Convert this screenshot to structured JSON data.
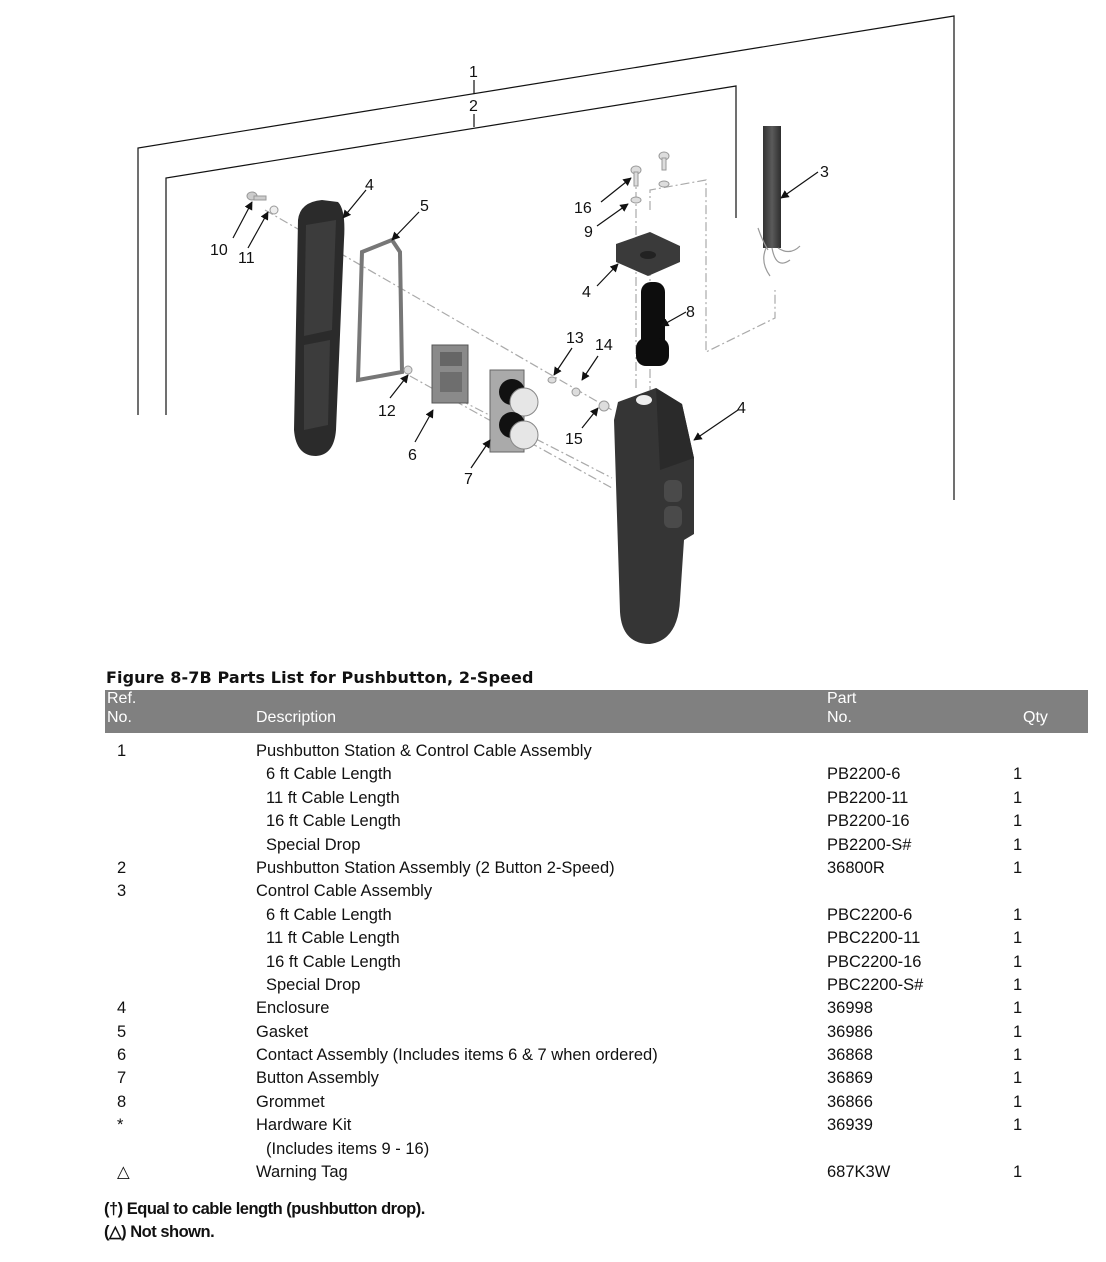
{
  "diagram": {
    "callouts": [
      "1",
      "2",
      "3",
      "4",
      "5",
      "4",
      "4",
      "8",
      "16",
      "9",
      "10",
      "11",
      "12",
      "6",
      "7",
      "13",
      "14",
      "15"
    ]
  },
  "figure_title": "Figure 8-7B  Parts List for Pushbutton, 2-Speed",
  "table": {
    "headers": {
      "ref_line1": "Ref.",
      "ref_line2": "No.",
      "description": "Description",
      "part_line1": "Part",
      "part_line2": "No.",
      "qty": "Qty"
    },
    "rows": [
      {
        "ref": "1",
        "description": "Pushbutton Station & Control Cable Assembly",
        "part": "",
        "qty": "",
        "sub": false
      },
      {
        "ref": "",
        "description": "6 ft Cable Length",
        "part": "PB2200-6",
        "qty": "1",
        "sub": true
      },
      {
        "ref": "",
        "description": "11 ft Cable Length",
        "part": "PB2200-11",
        "qty": "1",
        "sub": true
      },
      {
        "ref": "",
        "description": "16 ft Cable Length",
        "part": "PB2200-16",
        "qty": "1",
        "sub": true
      },
      {
        "ref": "",
        "description": "Special Drop",
        "part": "PB2200-S#",
        "qty": "1",
        "sub": true
      },
      {
        "ref": "2",
        "description": "Pushbutton Station Assembly (2 Button 2-Speed)",
        "part": "36800R",
        "qty": "1",
        "sub": false
      },
      {
        "ref": "3",
        "description": "Control Cable Assembly",
        "part": "",
        "qty": "",
        "sub": false
      },
      {
        "ref": "",
        "description": "6 ft Cable Length",
        "part": "PBC2200-6",
        "qty": "1",
        "sub": true
      },
      {
        "ref": "",
        "description": "11 ft Cable Length",
        "part": "PBC2200-11",
        "qty": "1",
        "sub": true
      },
      {
        "ref": "",
        "description": "16 ft Cable Length",
        "part": "PBC2200-16",
        "qty": "1",
        "sub": true
      },
      {
        "ref": "",
        "description": "Special Drop",
        "part": "PBC2200-S#",
        "qty": "1",
        "sub": true
      },
      {
        "ref": "4",
        "description": "Enclosure",
        "part": "36998",
        "qty": "1",
        "sub": false
      },
      {
        "ref": "5",
        "description": "Gasket",
        "part": "36986",
        "qty": "1",
        "sub": false
      },
      {
        "ref": "6",
        "description": "Contact Assembly (Includes items 6 & 7 when ordered)",
        "part": "36868",
        "qty": "1",
        "sub": false
      },
      {
        "ref": "7",
        "description": "Button Assembly",
        "part": "36869",
        "qty": "1",
        "sub": false
      },
      {
        "ref": "8",
        "description": "Grommet",
        "part": "36866",
        "qty": "1",
        "sub": false
      },
      {
        "ref": "*",
        "description": "Hardware Kit",
        "part": "36939",
        "qty": "1",
        "sub": false
      },
      {
        "ref": "",
        "description": "(Includes items 9 - 16)",
        "part": "",
        "qty": "",
        "sub": true
      },
      {
        "ref": "△",
        "description": "Warning Tag",
        "part": "687K3W",
        "qty": "1",
        "sub": false
      }
    ]
  },
  "footnotes": [
    "(†)  Equal to cable length (pushbutton drop).",
    "(△)   Not shown."
  ]
}
